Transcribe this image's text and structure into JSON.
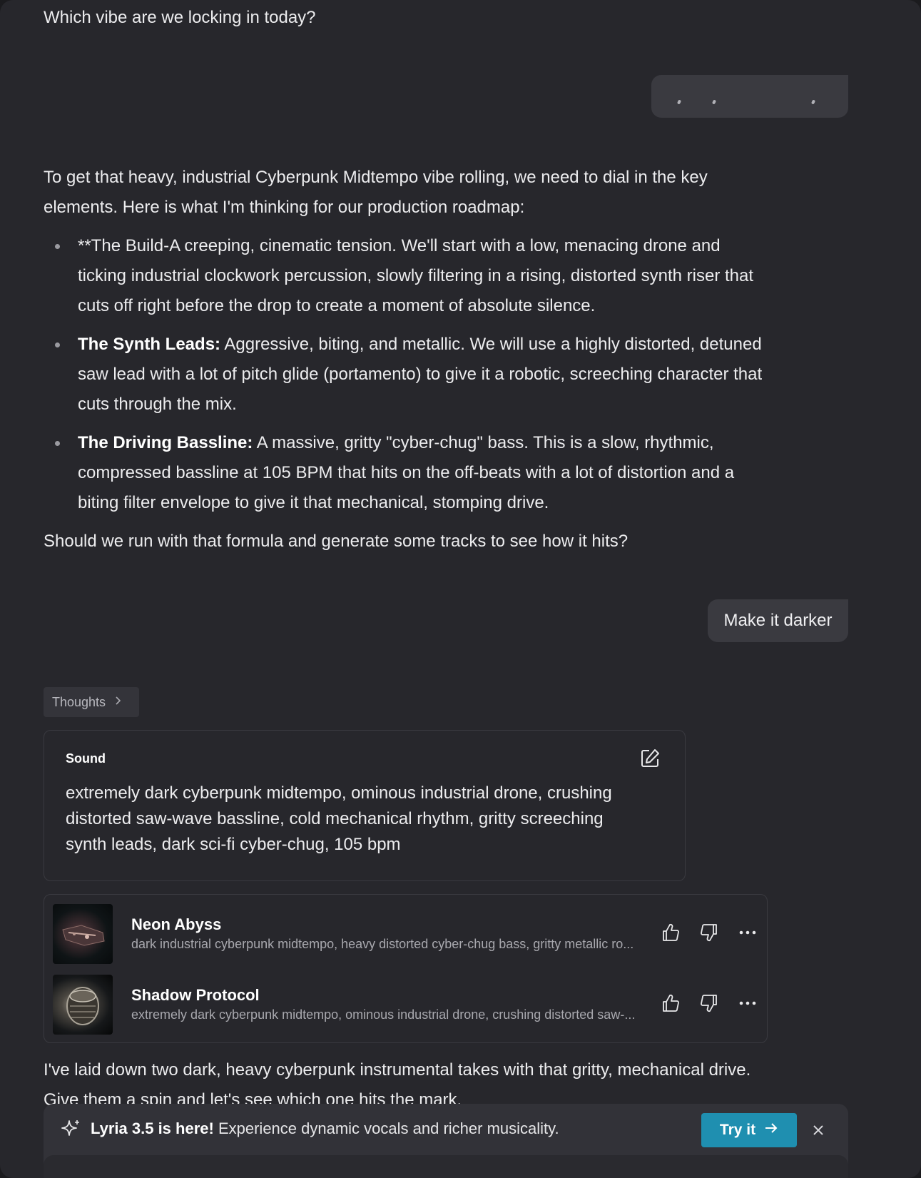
{
  "chat": {
    "intro_line": "Which vibe are we locking in today?",
    "reply1": {
      "intro": "To get that heavy, industrial Cyberpunk Midtempo vibe rolling, we need to dial in the key elements. Here is what I'm thinking for our production roadmap:",
      "bullets": [
        {
          "bold": "",
          "text": "**The Build-A creeping, cinematic tension. We'll start with a low, menacing drone and ticking industrial clockwork percussion, slowly filtering in a rising, distorted synth riser that cuts off right before the drop to create a moment of absolute silence."
        },
        {
          "bold": "The Synth Leads:",
          "text": " Aggressive, biting, and metallic. We will use a highly distorted, detuned saw lead with a lot of pitch glide (portamento) to give it a robotic, screeching character that cuts through the mix."
        },
        {
          "bold": "The Driving Bassline:",
          "text": " A massive, gritty \"cyber-chug\" bass. This is a slow, rhythmic, compressed bassline at 105 BPM that hits on the off-beats with a lot of distortion and a biting filter envelope to give it that mechanical, stomping drive."
        }
      ],
      "closing": "Should we run with that formula and generate some tracks to see how it hits?"
    },
    "user_message": "Make it darker",
    "thoughts_label": "Thoughts",
    "sound": {
      "title": "Sound",
      "prompt": "extremely dark cyberpunk midtempo, ominous industrial drone, crushing distorted saw-wave bassline, cold mechanical rhythm, gritty screeching synth leads, dark sci-fi cyber-chug, 105 bpm"
    },
    "tracks": [
      {
        "title": "Neon Abyss",
        "description": "dark industrial cyberpunk midtempo, heavy distorted cyber-chug bass, gritty metallic ro..."
      },
      {
        "title": "Shadow Protocol",
        "description": "extremely dark cyberpunk midtempo, ominous industrial drone, crushing distorted saw-..."
      }
    ],
    "final_reply": "I've laid down two dark, heavy cyberpunk instrumental takes with that gritty, mechanical drive. Give them a spin and let's see which one hits the mark."
  },
  "banner": {
    "headline": "Lyria 3.5 is here!",
    "text": " Experience dynamic vocals and richer musicality.",
    "button_label": "Try it",
    "accent": "#1f8fb0"
  },
  "icons": {
    "edit": "edit-icon",
    "thumbs_up": "thumbs-up-icon",
    "thumbs_down": "thumbs-down-icon",
    "more": "more-icon",
    "sparkle": "sparkle-icon",
    "close": "close-icon",
    "arrow": "arrow-right-icon",
    "chevron": "chevron-right-icon"
  }
}
